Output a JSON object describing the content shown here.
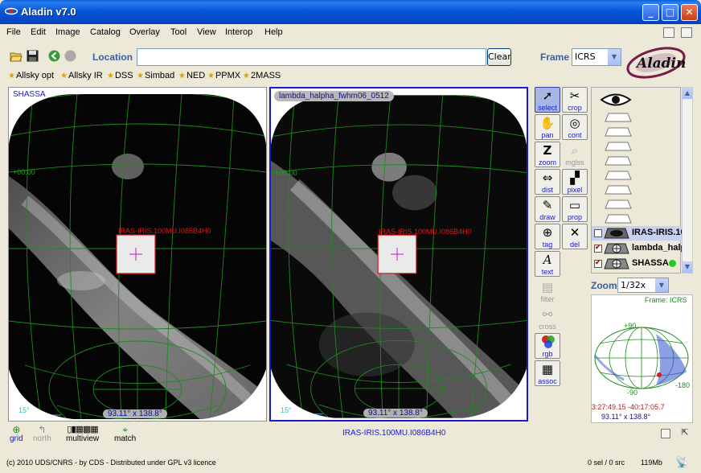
{
  "window": {
    "title": "Aladin v7.0",
    "minimize": "_",
    "maximize": "□",
    "close": "✕"
  },
  "menu": [
    "File",
    "Edit",
    "Image",
    "Catalog",
    "Overlay",
    "Tool",
    "View",
    "Interop",
    "Help"
  ],
  "toolbar": {
    "location_label": "Location",
    "location_value": "",
    "clear_label": "Clear",
    "frame_label": "Frame",
    "frame_value": "ICRS"
  },
  "bookmarks": [
    "Allsky opt",
    "Allsky IR",
    "DSS",
    "Simbad",
    "NED",
    "PPMX",
    "2MASS"
  ],
  "views": {
    "left": {
      "label": "SHASSA",
      "grid_dec_label": "+00:00",
      "target_label": "IRAS-IRIS.100MU.I086B4H0",
      "scale_label": "15°",
      "fov_label": "93.11° x 138.8°"
    },
    "right": {
      "label": "lambda_halpha_fwhm06_0512",
      "grid_dec_label": "+00:00",
      "target_label": "IRAS-IRIS.100MU.I086B4H0",
      "scale_label": "15°",
      "fov_label": "93.11° x 138.8°"
    }
  },
  "tools": [
    {
      "label": "select",
      "icon": "cursor-arrow-icon",
      "state": "active"
    },
    {
      "label": "crop",
      "icon": "scissors-icon",
      "state": "normal"
    },
    {
      "label": "pan",
      "icon": "hand-icon",
      "state": "normal"
    },
    {
      "label": "cont",
      "icon": "contour-icon",
      "state": "normal"
    },
    {
      "label": "zoom",
      "icon": "zoom-z-icon",
      "state": "normal"
    },
    {
      "label": "mglss",
      "icon": "magnifier-icon",
      "state": "disabled"
    },
    {
      "label": "dist",
      "icon": "distance-icon",
      "state": "normal"
    },
    {
      "label": "pixel",
      "icon": "pixel-icon",
      "state": "normal"
    },
    {
      "label": "draw",
      "icon": "pencil-icon",
      "state": "normal"
    },
    {
      "label": "prop",
      "icon": "properties-icon",
      "state": "normal"
    },
    {
      "label": "tag",
      "icon": "tag-target-icon",
      "state": "normal"
    },
    {
      "label": "del",
      "icon": "delete-x-icon",
      "state": "normal"
    },
    {
      "label": "text",
      "icon": "text-a-icon",
      "state": "normal"
    },
    {
      "label": "filter",
      "icon": "filter-icon",
      "state": "disabled"
    },
    {
      "label": "cross",
      "icon": "crossmatch-icon",
      "state": "disabled"
    },
    {
      "label": "rgb",
      "icon": "rgb-circles-icon",
      "state": "normal"
    },
    {
      "label": "assoc",
      "icon": "film-strip-icon",
      "state": "normal"
    }
  ],
  "layers": [
    {
      "name": "IRAS-IRIS.100MU.I086B4H0",
      "checked": false,
      "selected": true
    },
    {
      "name": "lambda_halpha_fwhm06_0512",
      "checked": true,
      "selected": false
    },
    {
      "name": "SHASSA",
      "checked": true,
      "selected": false
    }
  ],
  "zoom": {
    "label": "Zoom",
    "value": "1/32x"
  },
  "panner": {
    "frame_label": "Frame: ICRS",
    "top_label": "+90",
    "bottom_label": "-90",
    "right_label": "-180",
    "coords": "3:27:49.15 -40:17:05.7",
    "fov": "93.11° x 138.8°"
  },
  "bottom": {
    "grid": "grid",
    "north": "north",
    "multiview": "multiview",
    "match": "match",
    "current_plane": "IRAS-IRIS.100MU.I086B4H0"
  },
  "status": {
    "credits": "(c) 2010 UDS/CNRS - by CDS - Distributed under GPL v3 licence",
    "selection": "0 sel / 0 src",
    "memory": "119Mb"
  },
  "colors": {
    "title_blue": "#0548c8",
    "grid_green": "#1f8a1f",
    "target_red": "#e01818",
    "view_blue_label": "#1a1ac8",
    "active_view_border": "#1a1ac8"
  }
}
